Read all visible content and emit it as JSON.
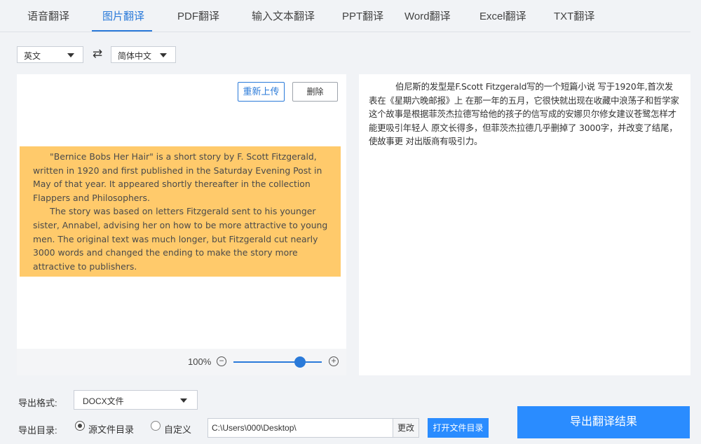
{
  "tabs": [
    {
      "label": "语音翻译",
      "active": false
    },
    {
      "label": "图片翻译",
      "active": true
    },
    {
      "label": "PDF翻译",
      "active": false
    },
    {
      "label": "输入文本翻译",
      "active": false
    },
    {
      "label": "PPT翻译",
      "active": false
    },
    {
      "label": "Word翻译",
      "active": false
    },
    {
      "label": "Excel翻译",
      "active": false
    },
    {
      "label": "TXT翻译",
      "active": false
    }
  ],
  "languages": {
    "source": "英文",
    "target": "简体中文",
    "swap_icon": "swap-arrows-icon"
  },
  "left_panel": {
    "reupload_label": "重新上传",
    "delete_label": "删除",
    "image_text": {
      "paragraph1": "\"Bernice Bobs Her Hair\" is a short story by F. Scott Fitzgerald, written in 1920 and first published in the Saturday Evening Post in May of that year. It appeared shortly thereafter in the collection Flappers and Philosophers.",
      "paragraph2": "The story was based on letters Fitzgerald sent to his younger sister, Annabel, advising her on how to be more attractive to young men. The original text was much longer, but Fitzgerald cut nearly 3000 words and changed the ending to make the story more attractive to publishers."
    },
    "zoom": {
      "level_text": "100%",
      "slider_value": 0.75,
      "minus_icon": "zoom-out-icon",
      "plus_icon": "zoom-in-icon"
    }
  },
  "right_panel": {
    "translated_text": "伯尼斯的发型是F.Scott Fitzgerald写的一个短篇小说 写于1920年,首次发表在《星期六晚邮报》上 在那一年的五月，它很快就出现在收藏中浪荡子和哲学家　　这个故事是根据菲茨杰拉德写给他的孩子的信写成的安娜贝尔修女建议苍鹭怎样才能更吸引年轻人 原文长得多，但菲茨杰拉德几乎删掉了 3000字，并改变了结尾，使故事更 对出版商有吸引力。"
  },
  "export": {
    "format_label": "导出格式:",
    "format_value": "DOCX文件",
    "dir_label": "导出目录:",
    "radio_source_label": "源文件目录",
    "radio_custom_label": "自定义",
    "selected_radio": "source",
    "path_value": "C:\\Users\\000\\Desktop\\",
    "change_label": "更改",
    "open_dir_label": "打开文件目录",
    "export_button_label": "导出翻译结果"
  },
  "colors": {
    "accent": "#2a7ad9",
    "primary_button": "#2a8cff",
    "image_highlight": "#ffca6b",
    "background": "#f1f3f6"
  }
}
